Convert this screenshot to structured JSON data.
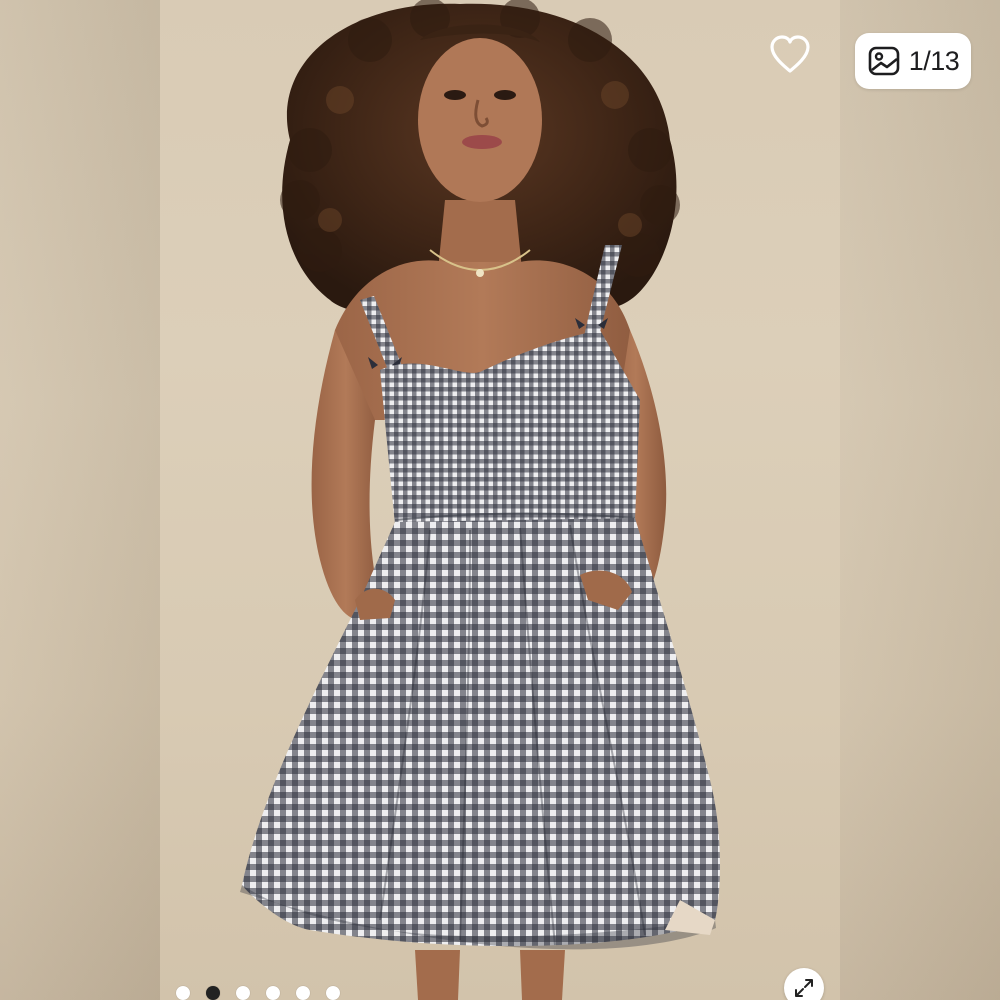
{
  "viewer": {
    "counter_text": "1/13",
    "current_index": 1,
    "total_images": 13,
    "icons": {
      "favorite": "heart-icon",
      "gallery": "image-gallery-icon",
      "expand": "expand-icon"
    },
    "visible_dots": 6,
    "active_dot": 1,
    "colors": {
      "backdrop": "#d9cbb5",
      "dot_active": "#222222",
      "dot_inactive": "#ffffff",
      "counter_bg": "#ffffff"
    }
  }
}
